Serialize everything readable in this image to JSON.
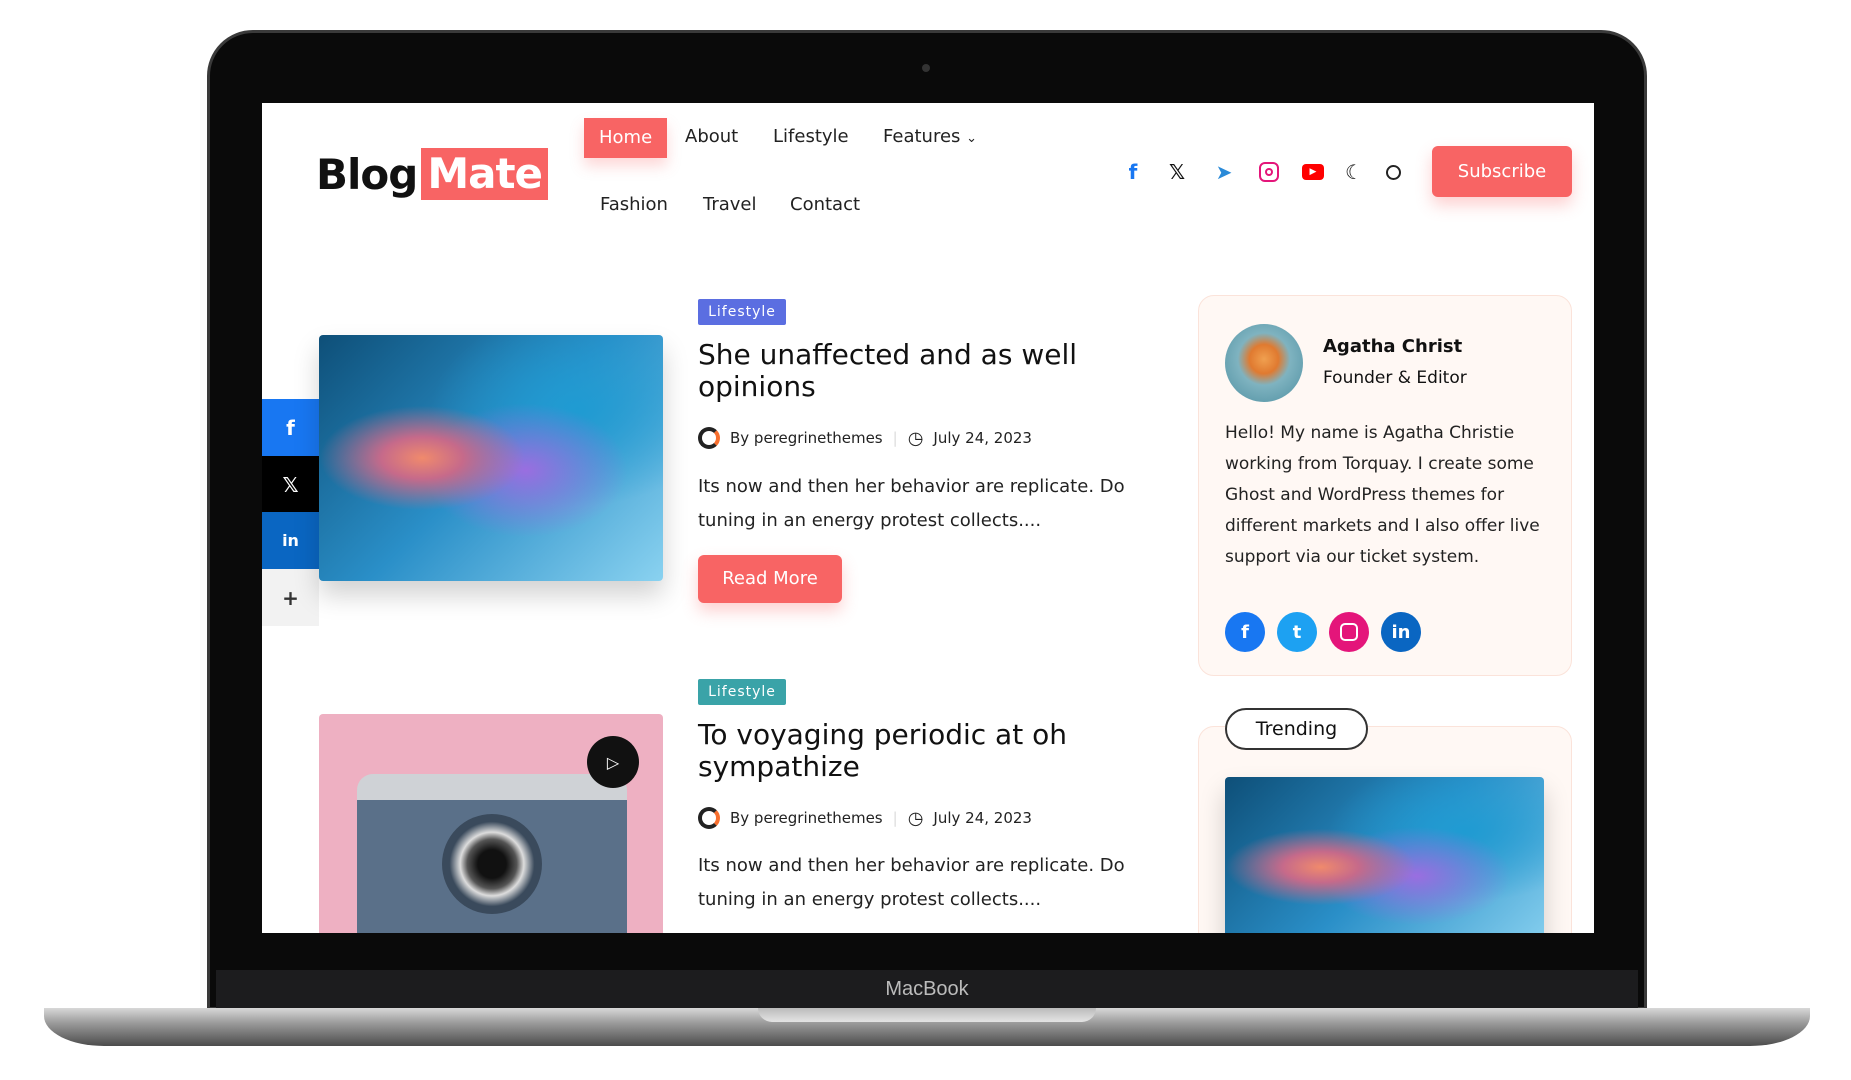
{
  "device_label": "MacBook",
  "logo": {
    "part1": "Blog",
    "part2": "Mate"
  },
  "nav": {
    "items": [
      "Home",
      "About",
      "Lifestyle",
      "Features",
      "Fashion",
      "Travel",
      "Contact"
    ],
    "active": "Home"
  },
  "header_icons": [
    "facebook-icon",
    "x-icon",
    "telegram-icon",
    "instagram-icon",
    "youtube-icon",
    "dark-mode-moon-icon",
    "search-icon"
  ],
  "subscribe_label": "Subscribe",
  "share_bar": [
    "facebook",
    "x",
    "linkedin",
    "more"
  ],
  "posts": [
    {
      "category": "Lifestyle",
      "category_color": "#5b6ee1",
      "title": "She unaffected and as well opinions",
      "author": "By peregrinethemes",
      "date": "July 24, 2023",
      "excerpt": "Its now and then her behavior are replicate. Do tuning in an energy protest collects....",
      "read_more": "Read More"
    },
    {
      "category": "Lifestyle",
      "category_color": "#3aa3a8",
      "title": "To voyaging periodic at oh sympathize",
      "author": "By peregrinethemes",
      "date": "July 24, 2023",
      "excerpt": "Its now and then her behavior are replicate. Do tuning in an energy protest collects....",
      "has_video": true
    }
  ],
  "author_card": {
    "name": "Agatha Christ",
    "role": "Founder & Editor",
    "bio": "Hello! My name is Agatha Christie working from Torquay. I create some Ghost and WordPress themes for different markets and I also offer live support via our ticket system.",
    "socials": [
      "facebook",
      "twitter",
      "instagram",
      "linkedin"
    ]
  },
  "trending": {
    "label": "Trending"
  },
  "colors": {
    "accent": "#f86464",
    "facebook": "#1877f2",
    "twitter": "#1da1f2",
    "instagram": "#e4157a",
    "linkedin": "#0a66c2"
  }
}
